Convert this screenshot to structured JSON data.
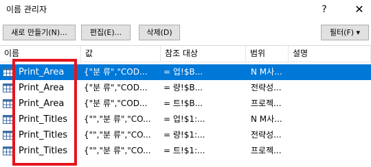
{
  "window": {
    "title": "이름 관리자",
    "help": "?",
    "close": "✕"
  },
  "toolbar": {
    "new_label": "새로 만들기(N)...",
    "edit_label": "편집(E)...",
    "delete_label": "삭제(D)",
    "filter_label": "필터(F) ▾"
  },
  "columns": [
    "이름",
    "값",
    "참조 대상",
    "범위",
    "설명"
  ],
  "rows": [
    {
      "name": "Print_Area",
      "value": "{\"분 류\",\"COD...",
      "refers": "=          업!$B...",
      "scope": "N M사...",
      "selected": true
    },
    {
      "name": "Print_Area",
      "value": "{\"분 류\",\"COD...",
      "refers": "=          량!$B...",
      "scope": "전략성...",
      "selected": false
    },
    {
      "name": "Print_Area",
      "value": "{\"분 류\",\"COD...",
      "refers": "=          트!$B...",
      "scope": "프로젝...",
      "selected": false
    },
    {
      "name": "Print_Titles",
      "value": "{\"\",\"분 류\",\"CO...",
      "refers": "=          업!$1:...",
      "scope": "N M사...",
      "selected": false
    },
    {
      "name": "Print_Titles",
      "value": "{\"\",\"분 류\",\"CO...",
      "refers": "=          량!$1:...",
      "scope": "전략성...",
      "selected": false
    },
    {
      "name": "Print_Titles",
      "value": "{\"\",\"분 류\",\"CO...",
      "refers": "=          트!$1:...",
      "scope": "프로젝...",
      "selected": false
    }
  ],
  "colors": {
    "selection": "#0078d7",
    "highlight_box": "#e4141c"
  }
}
